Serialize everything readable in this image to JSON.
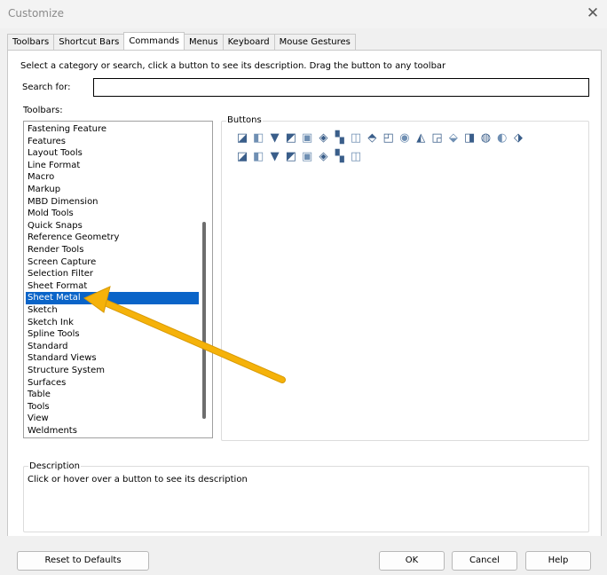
{
  "window": {
    "title": "Customize"
  },
  "tabs": [
    "Toolbars",
    "Shortcut Bars",
    "Commands",
    "Menus",
    "Keyboard",
    "Mouse Gestures"
  ],
  "active_tab": "Commands",
  "instructions": "Select a category or search, click a button to see its description. Drag the button to any toolbar",
  "search": {
    "label": "Search for:",
    "value": ""
  },
  "toolbars": {
    "label": "Toolbars:",
    "items": [
      "Fastening Feature",
      "Features",
      "Layout Tools",
      "Line Format",
      "Macro",
      "Markup",
      "MBD Dimension",
      "Mold Tools",
      "Quick Snaps",
      "Reference Geometry",
      "Render Tools",
      "Screen Capture",
      "Selection Filter",
      "Sheet Format",
      "Sheet Metal",
      "Sketch",
      "Sketch Ink",
      "Spline Tools",
      "Standard",
      "Standard Views",
      "Structure System",
      "Surfaces",
      "Table",
      "Tools",
      "View",
      "Weldments"
    ],
    "selected": "Sheet Metal"
  },
  "buttons": {
    "label": "Buttons",
    "row1": [
      "base-flange-icon",
      "convert-to-sheet-metal-icon",
      "lofted-bend-icon",
      "edge-flange-icon",
      "miter-flange-icon",
      "hem-icon",
      "jog-icon",
      "sketched-bend-icon",
      "cross-break-icon",
      "closed-corner-icon",
      "welded-corner-icon",
      "break-corner-icon",
      "corner-relief-icon",
      "forming-tool-icon",
      "tab-and-slot-icon",
      "vent-icon",
      "unfold-icon",
      "fold-icon"
    ],
    "row2": [
      "flatten-icon",
      "no-bends-icon",
      "rip-icon",
      "insert-bends-icon",
      "extruded-cut-icon",
      "simple-hole-icon",
      "sheet-metal-gusset-icon",
      "normal-cut-icon"
    ]
  },
  "description": {
    "label": "Description",
    "text": "Click or hover over a button to see its description"
  },
  "footer": {
    "reset_label": "Reset to Defaults",
    "ok_label": "OK",
    "cancel_label": "Cancel",
    "help_label": "Help"
  },
  "colors": {
    "selection": "#0a64c8",
    "annotation_arrow": "#f5b20a"
  }
}
